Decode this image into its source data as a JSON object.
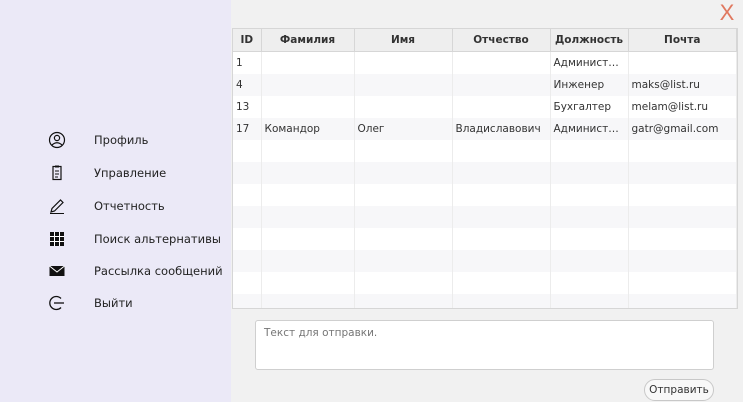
{
  "window": {
    "close_glyph": "X"
  },
  "sidebar": {
    "items": [
      {
        "label": "Профиль",
        "icon": "user-circle-icon"
      },
      {
        "label": "Управление",
        "icon": "clipboard-icon"
      },
      {
        "label": "Отчетность",
        "icon": "pencil-icon"
      },
      {
        "label": "Поиск альтернативы",
        "icon": "grid-icon"
      },
      {
        "label": "Рассылка сообщений",
        "icon": "envelope-icon"
      },
      {
        "label": "Выйти",
        "icon": "logout-icon"
      }
    ]
  },
  "table": {
    "headers": [
      "ID",
      "Фамилия",
      "Имя",
      "Отчество",
      "Должность",
      "Почта"
    ],
    "rows": [
      [
        "1",
        "",
        "",
        "",
        "Администра...",
        ""
      ],
      [
        "4",
        "",
        "",
        "",
        "Инженер",
        "maks@list.ru"
      ],
      [
        "13",
        "",
        "",
        "",
        "Бухгалтер",
        "melam@list.ru"
      ],
      [
        "17",
        "Командор",
        "Олег",
        "Владиславович",
        "Администра...",
        "gatr@gmail.com"
      ]
    ]
  },
  "message": {
    "placeholder": "Текст для отправки."
  },
  "send_button": {
    "label": "Отправить"
  },
  "colors": {
    "sidebar_bg": "#ebe9f7",
    "close": "#e0785f"
  }
}
